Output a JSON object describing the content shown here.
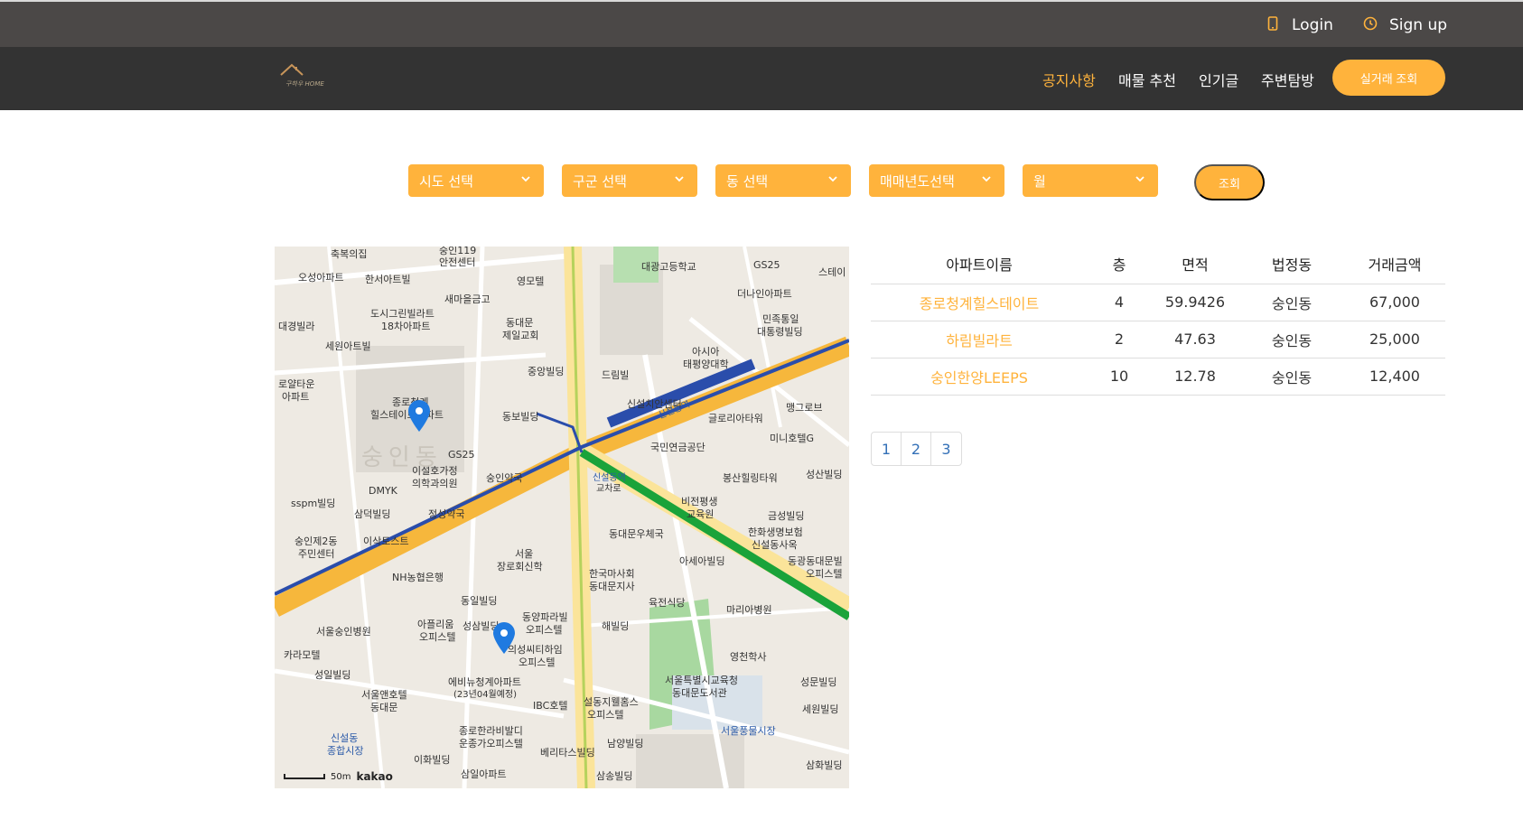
{
  "topbar": {
    "login_label": "Login",
    "signup_label": "Sign up",
    "login_icon": "phone-icon",
    "signup_icon": "clock-icon"
  },
  "navbar": {
    "logo_text": "구하우 HOME",
    "links": [
      "공지사항",
      "매물 추천",
      "인기글",
      "주변탐방"
    ],
    "cta_label": "실거래 조회"
  },
  "filters": {
    "selects": [
      "시도 선택",
      "구군 선택",
      "동 선택",
      "매매년도선택",
      "월"
    ],
    "search_label": "조회"
  },
  "map": {
    "labels": [
      {
        "text": "축복의집"
      },
      {
        "text": "숭인119"
      },
      {
        "text": "안전센터"
      },
      {
        "text": "대광고등학교"
      },
      {
        "text": "GS25"
      },
      {
        "text": "오성아파트"
      },
      {
        "text": "한서아트빌"
      },
      {
        "text": "영모텔"
      },
      {
        "text": "스테이"
      },
      {
        "text": "더나인아파트"
      },
      {
        "text": "새마을금고"
      },
      {
        "text": "도시그린빌라트"
      },
      {
        "text": "18차아파트"
      },
      {
        "text": "동대문"
      },
      {
        "text": "제일교회"
      },
      {
        "text": "민족통일"
      },
      {
        "text": "대통령빌딩"
      },
      {
        "text": "대경빌라"
      },
      {
        "text": "세원아트빌"
      },
      {
        "text": "아시아"
      },
      {
        "text": "태평양대학"
      },
      {
        "text": "중앙빌딩"
      },
      {
        "text": "드림빌"
      },
      {
        "text": "로얄타운"
      },
      {
        "text": "아파트"
      },
      {
        "text": "종로청계"
      },
      {
        "text": "힐스테이트아파트"
      },
      {
        "text": "신설치안센터"
      },
      {
        "text": "맹그로브"
      },
      {
        "text": "동보빌딩"
      },
      {
        "text": "글로리아타워"
      },
      {
        "text": "미니호텔G"
      },
      {
        "text": "국민연금공단"
      },
      {
        "text": "GS25"
      },
      {
        "text": "이설호가정"
      },
      {
        "text": "의학과의원"
      },
      {
        "text": "숭인약국"
      },
      {
        "text": "신설동역"
      },
      {
        "text": "교차로"
      },
      {
        "text": "봉산힐링타워"
      },
      {
        "text": "성산빌딩"
      },
      {
        "text": "DMYK"
      },
      {
        "text": "sspm빌딩"
      },
      {
        "text": "삼덕빌딩"
      },
      {
        "text": "정성약국"
      },
      {
        "text": "비전평생"
      },
      {
        "text": "교육원"
      },
      {
        "text": "금성빌딩"
      },
      {
        "text": "숭인제2동"
      },
      {
        "text": "주민센터"
      },
      {
        "text": "이삭토스트"
      },
      {
        "text": "서울"
      },
      {
        "text": "장로회신학"
      },
      {
        "text": "동대문우체국"
      },
      {
        "text": "한화생명보험"
      },
      {
        "text": "신설동사옥"
      },
      {
        "text": "아세아빌딩"
      },
      {
        "text": "동광동대문빌"
      },
      {
        "text": "오피스텔"
      },
      {
        "text": "NH농협은행"
      },
      {
        "text": "한국마사회"
      },
      {
        "text": "동대문지사"
      },
      {
        "text": "동일빌딩"
      },
      {
        "text": "육전식당"
      },
      {
        "text": "마리아병원"
      },
      {
        "text": "동양파라빌"
      },
      {
        "text": "오피스텔"
      },
      {
        "text": "아플리움"
      },
      {
        "text": "오피스텔"
      },
      {
        "text": "성삼빌딩"
      },
      {
        "text": "해빌딩"
      },
      {
        "text": "서울숭인병원"
      },
      {
        "text": "의성씨티하임"
      },
      {
        "text": "오피스텔"
      },
      {
        "text": "카라모텔"
      },
      {
        "text": "영천학사"
      },
      {
        "text": "성일빌딩"
      },
      {
        "text": "에비뉴청계아파트"
      },
      {
        "text": "(23년04월예정)"
      },
      {
        "text": "서울특별시교육청"
      },
      {
        "text": "동대문도서관"
      },
      {
        "text": "성문빌딩"
      },
      {
        "text": "서울앤호텔"
      },
      {
        "text": "동대문"
      },
      {
        "text": "IBC호텔"
      },
      {
        "text": "설동지웰홈스"
      },
      {
        "text": "오피스텔"
      },
      {
        "text": "세원빌딩"
      },
      {
        "text": "신설동"
      },
      {
        "text": "종합시장"
      },
      {
        "text": "종로한라비발디"
      },
      {
        "text": "운종가오피스텔"
      },
      {
        "text": "서울풍물시장"
      },
      {
        "text": "베리타스빌딩"
      },
      {
        "text": "남양빌딩"
      },
      {
        "text": "이화빌딩"
      },
      {
        "text": "삼화빌딩"
      },
      {
        "text": "삼일아파트"
      },
      {
        "text": "삼송빌딩"
      },
      {
        "text": "신설동역"
      },
      {
        "text": "숭인동"
      }
    ],
    "scale_text": "50m",
    "brand": "kakao",
    "colors": {
      "line1": "#2a4dab",
      "line2": "#1aa33a",
      "road": "#f6b73c",
      "park": "#a8d8a0"
    }
  },
  "results": {
    "headers": [
      "아파트이름",
      "층",
      "면적",
      "법정동",
      "거래금액"
    ],
    "rows": [
      [
        "종로청계힐스테이트",
        "4",
        "59.9426",
        "숭인동",
        "67,000"
      ],
      [
        "하림빌라트",
        "2",
        "47.63",
        "숭인동",
        "25,000"
      ],
      [
        "숭인한양LEEPS",
        "10",
        "12.78",
        "숭인동",
        "12,400"
      ]
    ]
  },
  "pager": {
    "pages": [
      "1",
      "2",
      "3"
    ]
  },
  "colors": {
    "accent": "#ffb33c",
    "topbar": "#4b4847",
    "navbar": "#333333",
    "link": "#3370b7"
  }
}
